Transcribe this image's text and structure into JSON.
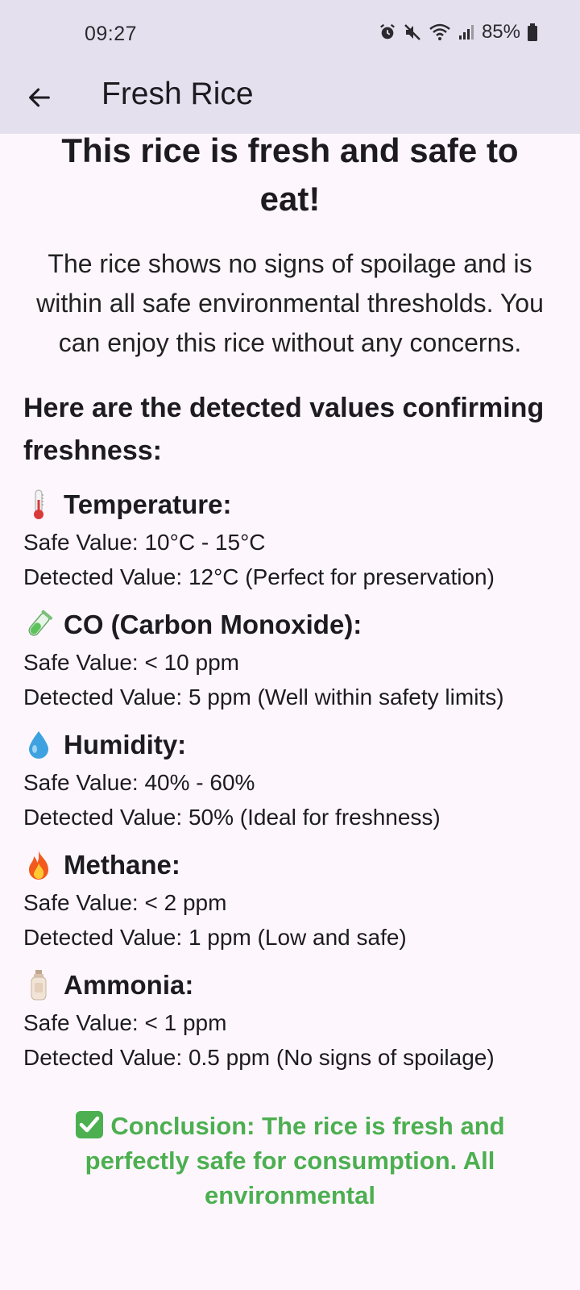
{
  "status_bar": {
    "time": "09:27",
    "battery": "85%",
    "icons": [
      "alarm-icon",
      "mute-icon",
      "wifi-icon",
      "signal-icon",
      "battery-icon"
    ]
  },
  "app_bar": {
    "back_icon": "arrow-left-icon",
    "title": "Fresh Rice"
  },
  "main": {
    "headline": "This rice is fresh and safe to eat!",
    "intro": "The rice shows no signs of spoilage and is within all safe environmental thresholds. You can enjoy this rice without any concerns.",
    "section_heading": "Here are the detected values confirming freshness:",
    "metrics": [
      {
        "icon": "thermometer-icon",
        "title": "Temperature:",
        "safe": "Safe Value: 10°C - 15°C",
        "detected": "Detected Value: 12°C (Perfect for preservation)"
      },
      {
        "icon": "test-tube-icon",
        "title": "CO (Carbon Monoxide):",
        "safe": "Safe Value: < 10 ppm",
        "detected": "Detected Value: 5 ppm (Well within safety limits)"
      },
      {
        "icon": "droplet-icon",
        "title": "Humidity:",
        "safe": "Safe Value: 40% - 60%",
        "detected": "Detected Value: 50% (Ideal for freshness)"
      },
      {
        "icon": "fire-icon",
        "title": "Methane:",
        "safe": "Safe Value: < 2 ppm",
        "detected": "Detected Value: 1 ppm (Low and safe)"
      },
      {
        "icon": "lotion-bottle-icon",
        "title": "Ammonia:",
        "safe": "Safe Value: < 1 ppm",
        "detected": "Detected Value: 0.5 ppm (No signs of spoilage)"
      }
    ],
    "conclusion_icon": "check-mark-icon",
    "conclusion": "Conclusion: The rice is fresh and perfectly safe for consumption. All environmental"
  },
  "colors": {
    "app_bar_bg": "#e5e0ee",
    "page_bg": "#fdf7fd",
    "conclusion_green": "#4caf50"
  }
}
